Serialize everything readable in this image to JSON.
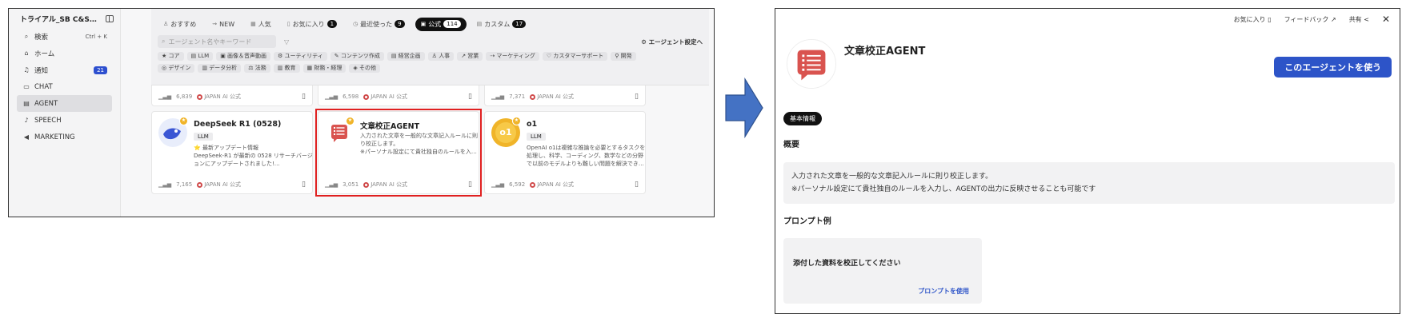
{
  "sidebar": {
    "workspace": "トライアル_SB C&S…",
    "items": [
      {
        "icon": "search-icon",
        "glyph": "⌕",
        "label": "検索",
        "extra": "Ctrl + K"
      },
      {
        "icon": "home-icon",
        "glyph": "⌂",
        "label": "ホーム",
        "extra": ""
      },
      {
        "icon": "bell-icon",
        "glyph": "♫",
        "label": "通知",
        "extra": "21"
      },
      {
        "icon": "chat-icon",
        "glyph": "▭",
        "label": "CHAT",
        "extra": ""
      },
      {
        "icon": "agent-icon",
        "glyph": "▤",
        "label": "AGENT",
        "extra": ""
      },
      {
        "icon": "mic-icon",
        "glyph": "♪",
        "label": "SPEECH",
        "extra": ""
      },
      {
        "icon": "megaphone-icon",
        "glyph": "◀",
        "label": "MARKETING",
        "extra": ""
      }
    ]
  },
  "tabs": [
    {
      "label": "おすすめ",
      "count": ""
    },
    {
      "label": "NEW",
      "count": ""
    },
    {
      "label": "人気",
      "count": ""
    },
    {
      "label": "お気に入り",
      "count": "1"
    },
    {
      "label": "最近使った",
      "count": "9"
    },
    {
      "label": "公式",
      "count": "114"
    },
    {
      "label": "カスタム",
      "count": "17"
    }
  ],
  "search": {
    "placeholder": "エージェント名やキーワード"
  },
  "agent_settings": "エージェント設定へ",
  "chips": [
    "コア",
    "LLM",
    "画像＆音声動画",
    "ユーティリティ",
    "コンテンツ作成",
    "経営企画",
    "人事",
    "営業",
    "マーケティング",
    "カスタマーサポート",
    "開発",
    "デザイン",
    "データ分析",
    "法務",
    "教育",
    "財務・経理",
    "その他"
  ],
  "top_row_cards": [
    {
      "count": "6,839",
      "publisher": "JAPAN AI 公式"
    },
    {
      "count": "6,598",
      "publisher": "JAPAN AI 公式"
    },
    {
      "count": "7,371",
      "publisher": "JAPAN AI 公式"
    }
  ],
  "cards": [
    {
      "title": "DeepSeek R1 (0528)",
      "tag": "LLM",
      "desc": "⭐ 最新アップデート情報\nDeepSeek-R1 が最新の 0528 リサーチバージョンにアップデートされました!…",
      "count": "7,165",
      "publisher": "JAPAN AI 公式"
    },
    {
      "title": "文章校正AGENT",
      "tag": "",
      "desc": "入力された文章を一般的な文章記入ルールに則り校正します。\n※パーソナル設定にて貴社独自のルールを入…",
      "count": "3,051",
      "publisher": "JAPAN AI 公式"
    },
    {
      "title": "o1",
      "tag": "LLM",
      "desc": "OpenAI o1は複雑な推論を必要とするタスクを処理し、科学、コーディング、数学などの分野で以前のモデルよりも難しい問題を解決でき…",
      "count": "6,592",
      "publisher": "JAPAN AI 公式"
    }
  ],
  "detail": {
    "favorite": "お気に入り",
    "feedback": "フィードバック",
    "share": "共有",
    "close": "✕",
    "title": "文章校正AGENT",
    "use_button": "このエージェントを使う",
    "info_pill": "基本情報",
    "overview_heading": "概要",
    "overview_line1": "入力された文章を一般的な文章記入ルールに則り校正します。",
    "overview_line2": "※パーソナル設定にて貴社独自のルールを入力し、AGENTの出力に反映させることも可能です",
    "prompt_heading": "プロンプト例",
    "prompt_example": "添付した資料を校正してください",
    "prompt_use": "プロンプトを使用"
  },
  "colors": {
    "accent": "#2d54c8",
    "highlight": "#e02020",
    "arrow": "#4472c4"
  }
}
